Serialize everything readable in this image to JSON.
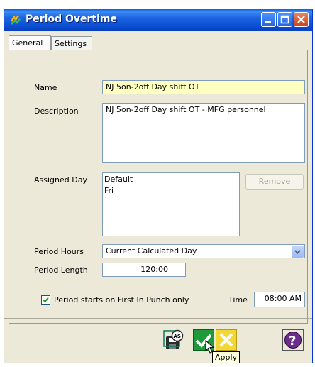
{
  "window": {
    "title": "Period Overtime"
  },
  "tabs": [
    {
      "label": "General",
      "active": true
    },
    {
      "label": "Settings",
      "active": false
    }
  ],
  "form": {
    "name_label": "Name",
    "name_value": "NJ 5on-2off Day shift OT",
    "description_label": "Description",
    "description_value": "NJ 5on-2off Day shift OT - MFG personnel",
    "assigned_day_label": "Assigned Day",
    "assigned_days": [
      "Default",
      "Fri"
    ],
    "remove_label": "Remove",
    "period_hours_label": "Period Hours",
    "period_hours_value": "Current Calculated Day",
    "period_length_label": "Period Length",
    "period_length_value": "120:00",
    "first_in_punch_label": "Period starts on First In Punch only",
    "first_in_punch_checked": true,
    "time_label": "Time",
    "time_value": "08:00 AM"
  },
  "footer": {
    "tooltip": "Apply",
    "colors": {
      "apply_green": "#1e9a3a",
      "cancel_yellow": "#f3d735",
      "help_purple": "#6a2d8c"
    }
  }
}
